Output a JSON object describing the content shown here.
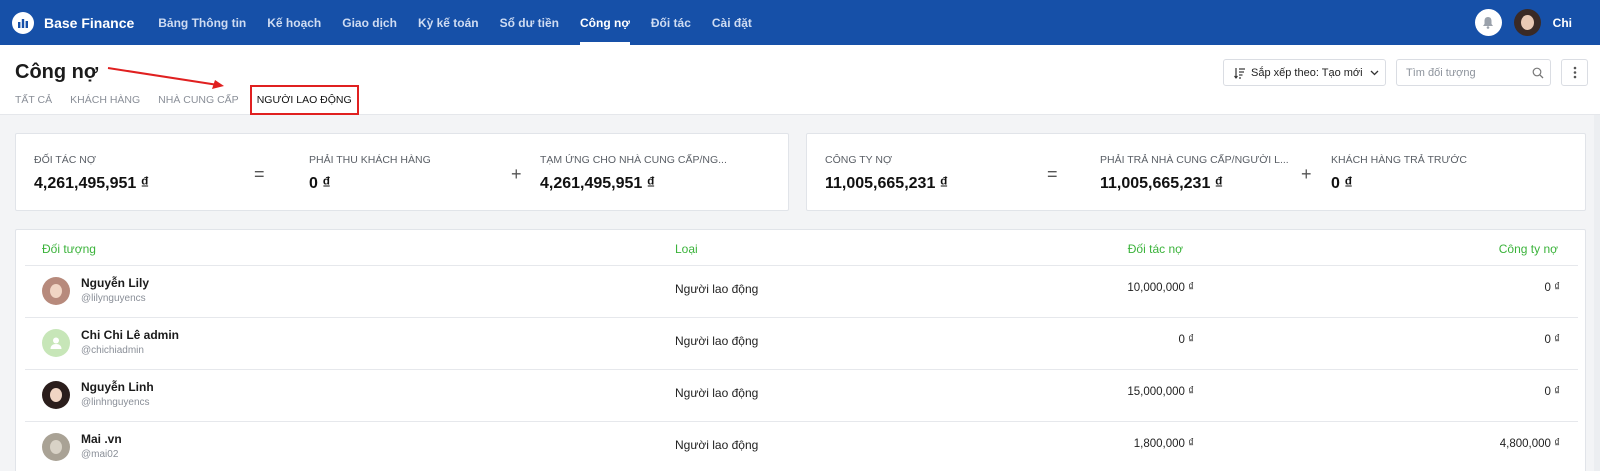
{
  "app": {
    "name": "Base Finance",
    "user_name": "Chi"
  },
  "nav": {
    "items": [
      {
        "label": "Bảng Thông tin",
        "active": false
      },
      {
        "label": "Kế hoạch",
        "active": false
      },
      {
        "label": "Giao dịch",
        "active": false
      },
      {
        "label": "Kỳ kế toán",
        "active": false
      },
      {
        "label": "Sổ dư tiền",
        "active": false
      },
      {
        "label": "Công nợ",
        "active": true
      },
      {
        "label": "Đối tác",
        "active": false
      },
      {
        "label": "Cài đặt",
        "active": false
      }
    ]
  },
  "page": {
    "title": "Công nợ",
    "tabs": [
      {
        "label": "TẤT CẢ",
        "active": false
      },
      {
        "label": "KHÁCH HÀNG",
        "active": false
      },
      {
        "label": "NHÀ CUNG CẤP",
        "active": false
      },
      {
        "label": "NGƯỜI LAO ĐỘNG",
        "active": true
      }
    ],
    "sort_label": "Sắp xếp theo: Tạo mới",
    "search_placeholder": "Tìm đối tượng"
  },
  "summary": {
    "partner_debt": {
      "label": "ĐỐI TÁC NỢ",
      "value": "4,261,495,951 ₫",
      "op1": "=",
      "receivable_label": "PHẢI THU KHÁCH HÀNG",
      "receivable_value": "0 ₫",
      "op2": "+",
      "advance_label": "TẠM ỨNG CHO NHÀ CUNG CẤP/NG...",
      "advance_value": "4,261,495,951 ₫"
    },
    "company_debt": {
      "label": "CÔNG TY NỢ",
      "value": "11,005,665,231 ₫",
      "op1": "=",
      "payable_label": "PHẢI TRẢ NHÀ CUNG CẤP/NGƯỜI L...",
      "payable_value": "11,005,665,231 ₫",
      "op2": "+",
      "prepaid_label": "KHÁCH HÀNG TRẢ TRƯỚC",
      "prepaid_value": "0 ₫"
    }
  },
  "table": {
    "headers": {
      "object": "Đối tượng",
      "type": "Loại",
      "partner_debt": "Đối tác nợ",
      "company_debt": "Công ty nợ"
    },
    "rows": [
      {
        "name": "Nguyễn Lily",
        "handle": "@lilynguyencs",
        "type": "Người lao động",
        "partner_debt": "10,000,000 ₫",
        "company_debt": "0 ₫"
      },
      {
        "name": "Chi Chi Lê admin",
        "handle": "@chichiadmin",
        "type": "Người lao động",
        "partner_debt": "0 ₫",
        "company_debt": "0 ₫"
      },
      {
        "name": "Nguyễn Linh",
        "handle": "@linhnguyencs",
        "type": "Người lao động",
        "partner_debt": "15,000,000 ₫",
        "company_debt": "0 ₫"
      },
      {
        "name": "Mai .vn",
        "handle": "@mai02",
        "type": "Người lao động",
        "partner_debt": "1,800,000 ₫",
        "company_debt": "4,800,000 ₫"
      }
    ]
  },
  "colors": {
    "nav_bg": "#1650a8",
    "header_green": "#3bb33b",
    "highlight_red": "#e02020"
  }
}
